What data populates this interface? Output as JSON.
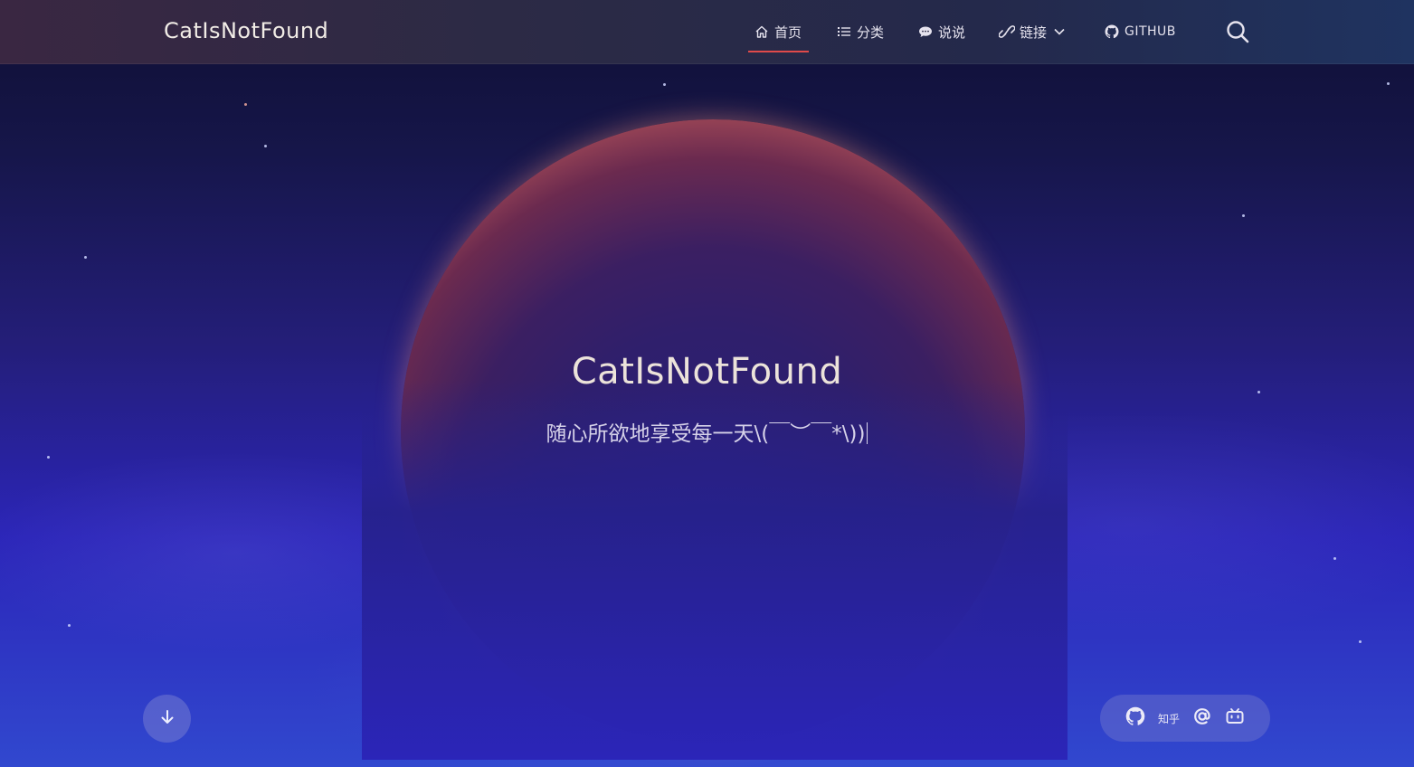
{
  "navbar": {
    "brand": "CatIsNotFound",
    "items": [
      {
        "label": "首页",
        "icon": "home-icon",
        "active": true
      },
      {
        "label": "分类",
        "icon": "list-icon"
      },
      {
        "label": "说说",
        "icon": "chat-icon"
      },
      {
        "label": "链接",
        "icon": "link-icon",
        "dropdown": true
      },
      {
        "label": "GITHUB",
        "icon": "github-icon"
      }
    ],
    "search_icon": "search-icon",
    "active_color": "#e04a4a"
  },
  "hero": {
    "title": "CatIsNotFound",
    "subtitle": "随心所欲地享受每一天\\(￣︶￣*\\))"
  },
  "footer_controls": {
    "scroll_down_icon": "arrow-down-icon",
    "social": [
      {
        "icon": "github-icon"
      },
      {
        "label": "知乎"
      },
      {
        "icon": "at-email-icon"
      },
      {
        "icon": "bilibili-icon"
      }
    ]
  }
}
